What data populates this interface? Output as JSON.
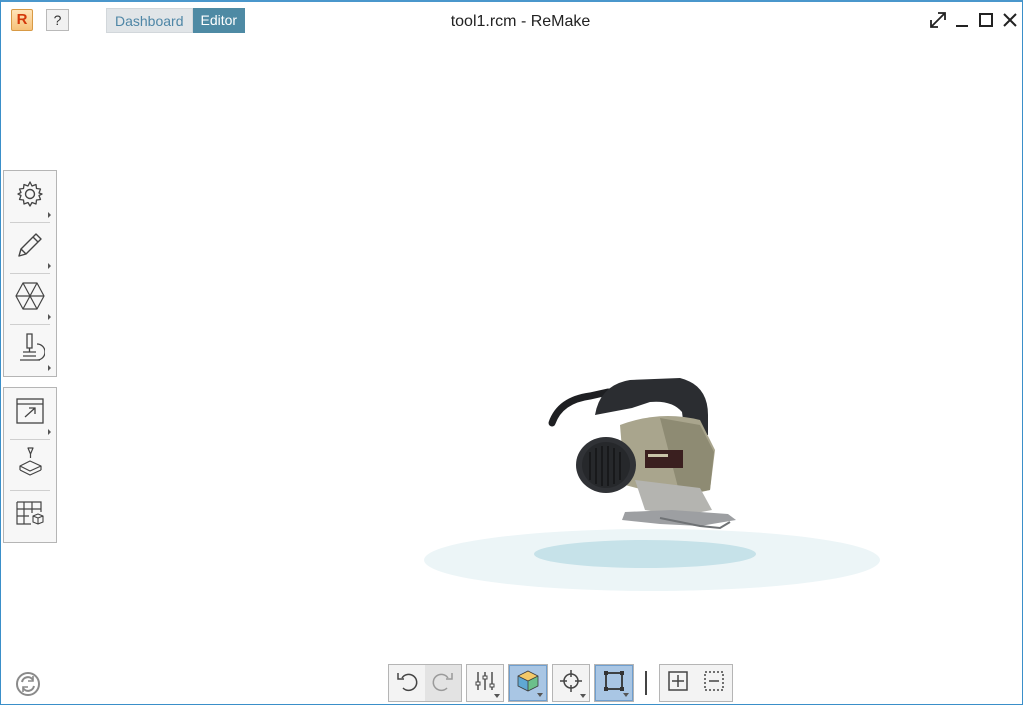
{
  "app": {
    "logo_letter": "R",
    "help_label": "?",
    "window_title": "tool1.rcm - ReMake"
  },
  "mode_tabs": [
    {
      "label": "Dashboard",
      "active": false
    },
    {
      "label": "Editor",
      "active": true
    }
  ],
  "window_controls": [
    "expand-icon",
    "minimize-icon",
    "maximize-icon",
    "close-icon"
  ],
  "left_rail_top": [
    {
      "name": "settings",
      "icon": "gear-icon"
    },
    {
      "name": "edit",
      "icon": "pencil-icon"
    },
    {
      "name": "model-analysis",
      "icon": "hexagon-mesh-icon"
    },
    {
      "name": "inspect",
      "icon": "microscope-icon"
    }
  ],
  "left_rail_bottom": [
    {
      "name": "export",
      "icon": "export-window-icon"
    },
    {
      "name": "print-3d",
      "icon": "3d-print-icon"
    },
    {
      "name": "table-view",
      "icon": "table-cube-icon"
    }
  ],
  "bottom_toolbar": [
    {
      "name": "undo",
      "icon": "undo-icon",
      "state": "normal"
    },
    {
      "name": "redo",
      "icon": "redo-icon",
      "state": "disabled"
    },
    {
      "name": "display-settings",
      "icon": "sliders-icon",
      "state": "normal"
    },
    {
      "name": "view-mode",
      "icon": "shaded-cube-icon",
      "state": "toggled"
    },
    {
      "name": "pivot",
      "icon": "crosshair-icon",
      "state": "normal"
    },
    {
      "name": "orthographic",
      "icon": "square-frame-icon",
      "state": "toggled"
    },
    {
      "name": "fit-all",
      "icon": "fit-all-icon",
      "state": "normal"
    },
    {
      "name": "fit-selection",
      "icon": "fit-selection-icon",
      "state": "normal"
    }
  ],
  "colors": {
    "accent": "#4e8aa4",
    "toggle_bg": "#a9c6e4",
    "ground_shadow": "#c6e2e9",
    "frame_border": "#3a8fc9"
  }
}
